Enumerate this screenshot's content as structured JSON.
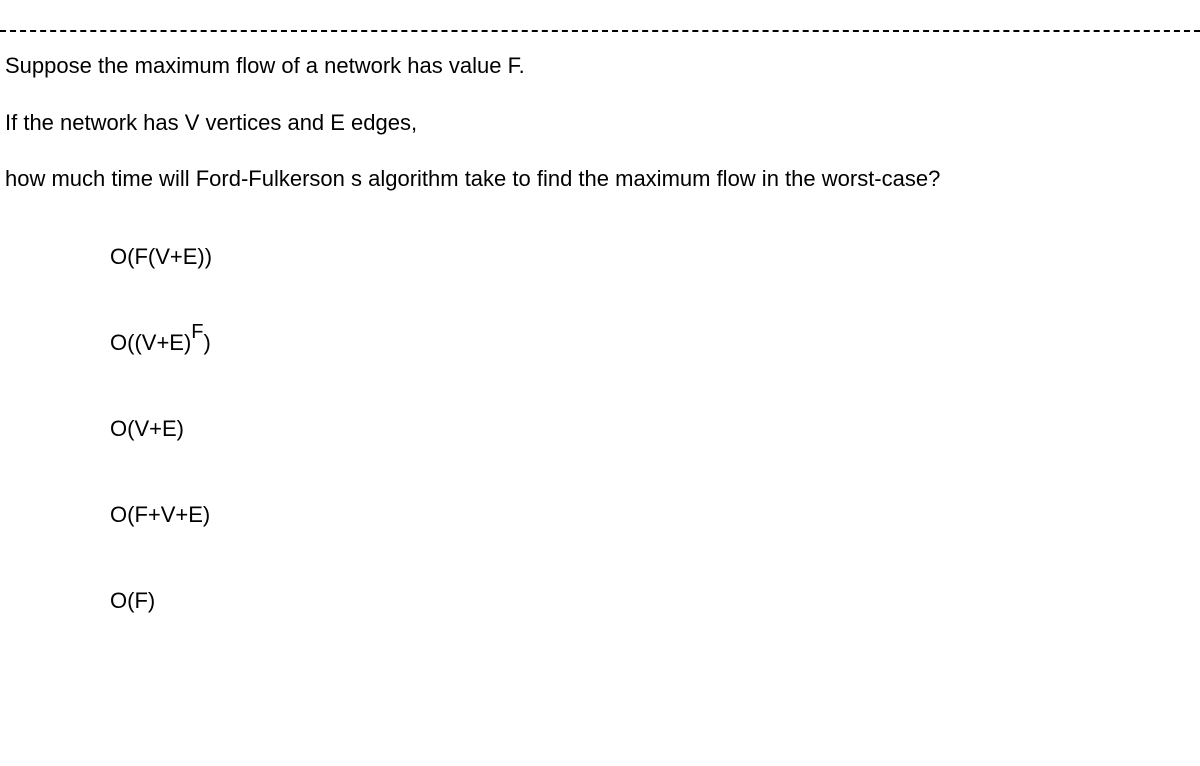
{
  "question": {
    "line1": "Suppose the maximum flow of a network has value F.",
    "line2": "If the network has V vertices and E edges,",
    "line3": "how much time will Ford-Fulkerson s algorithm take to find the maximum flow in the worst-case?"
  },
  "options": {
    "a": "O(F(V+E))",
    "b_prefix": "O((V+E)",
    "b_sup": "F",
    "b_suffix": ")",
    "c": "O(V+E)",
    "d": "O(F+V+E)",
    "e": "O(F)"
  }
}
